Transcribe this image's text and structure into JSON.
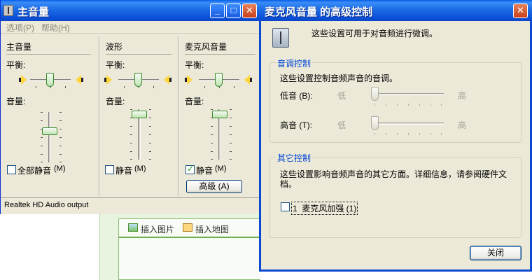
{
  "main_window": {
    "title": "主音量",
    "menu": [
      "选项(P)",
      "帮助(H)"
    ],
    "title_buttons": {
      "minimize": "_",
      "maximize": "□",
      "close": "✕"
    },
    "columns": [
      {
        "header": "主音量",
        "balance_label": "平衡:",
        "volume_label": "音量:",
        "mute_label": "全部静音",
        "mute_key": "(M)",
        "muted": false,
        "balance": 0.5,
        "volume": 0.42
      },
      {
        "header": "波形",
        "balance_label": "平衡:",
        "volume_label": "音量:",
        "mute_label": "静音",
        "mute_key": "(M)",
        "muted": false,
        "balance": 0.5,
        "volume": 0.88
      },
      {
        "header": "麦克风音量",
        "balance_label": "平衡:",
        "volume_label": "音量:",
        "mute_label": "静音",
        "mute_key": "(M)",
        "muted": true,
        "balance": 0.5,
        "volume": 0.88,
        "advanced_button": "高级 (A)"
      }
    ],
    "status": "Realtek HD Audio output"
  },
  "background_window": {
    "insert_image": "插入图片",
    "insert_map": "插入地图"
  },
  "advanced_dialog": {
    "title": "麦克风音量 的高级控制",
    "description": "这些设置可用于对音频进行微调。",
    "tone": {
      "group_title": "音调控制",
      "description": "这些设置控制音频声音的音调。",
      "bass_label": "低音 (B):",
      "treble_label": "高音 (T):",
      "low": "低",
      "high": "高",
      "bass": 0.0,
      "treble": 0.0
    },
    "other": {
      "group_title": "其它控制",
      "description_line1": "这些设置影响音频声音的其它方面。详细信息，请参阅硬件文",
      "description_line2": "档。",
      "boost_label": "1  麦克风加强 (1)",
      "boost_checked": false
    },
    "close_button": "关闭"
  },
  "colors": {
    "titlebar": "#0a4ad0",
    "window_bg": "#ece9d8",
    "group_title": "#0046d5",
    "thumb_green": "#3b8a2c"
  }
}
